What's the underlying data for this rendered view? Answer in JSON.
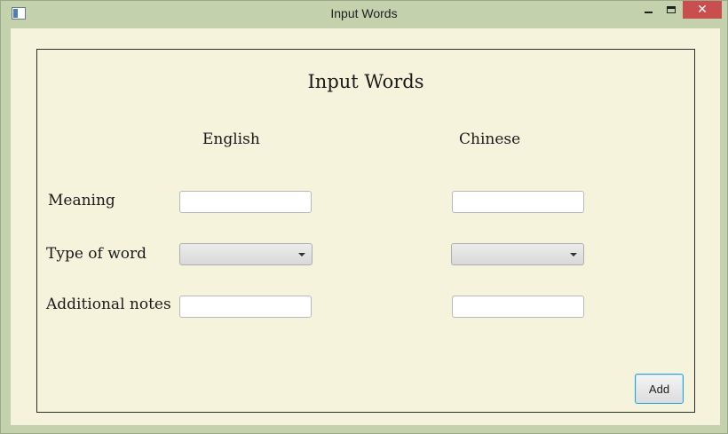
{
  "window": {
    "title": "Input Words",
    "close_glyph": "✕"
  },
  "form": {
    "title": "Input Words",
    "columns": [
      "English",
      "Chinese"
    ],
    "rows": [
      {
        "label": "Meaning",
        "type": "text",
        "english_value": "",
        "chinese_value": ""
      },
      {
        "label": "Type of word",
        "type": "select",
        "english_value": "",
        "chinese_value": ""
      },
      {
        "label": "Additional notes",
        "type": "text",
        "english_value": "",
        "chinese_value": ""
      }
    ],
    "add_label": "Add"
  },
  "icons": {
    "app": "window-app-icon",
    "minimize": "minimize-icon",
    "maximize": "maximize-icon",
    "close": "close-icon",
    "dropdown": "chevron-down-icon"
  },
  "colors": {
    "frame": "#c3d2ad",
    "client_background": "#f5f3dc",
    "close_button": "#c94f4f",
    "focus_border": "#2a9fd6"
  }
}
